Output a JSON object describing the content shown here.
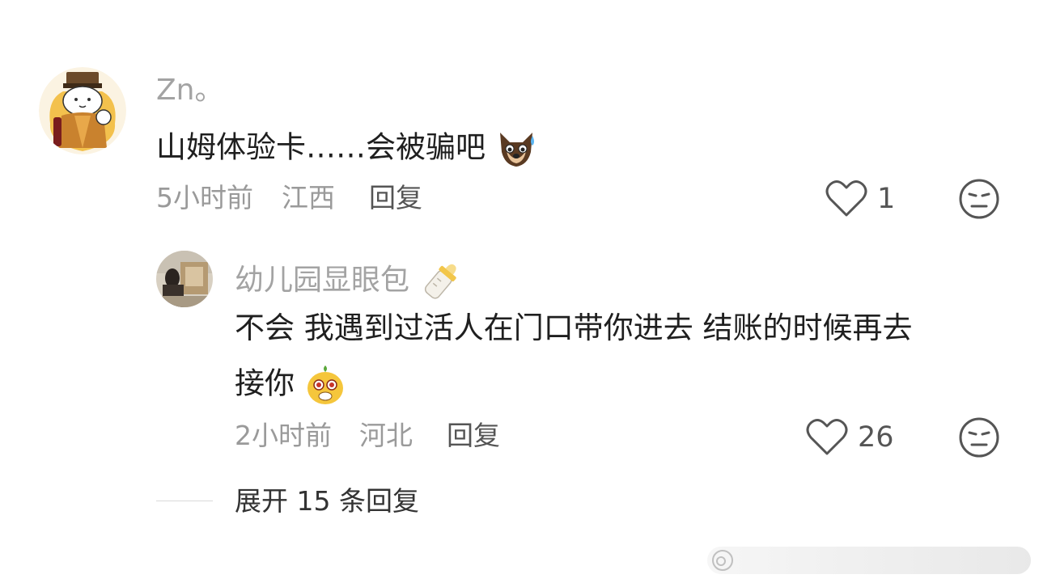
{
  "comment": {
    "username": "Zn。",
    "text": "山姆体验卡……会被骗吧",
    "emoji": "dog-sweat-emoji",
    "time": "5小时前",
    "location": "江西",
    "reply_label": "回复",
    "likes": "1",
    "avatar": "cat-emperor-avatar"
  },
  "reply": {
    "username": "幼儿园显眼包",
    "username_emoji": "baby-bottle-emoji",
    "text_line1": "不会 我遇到过活人在门口带你进去 结账的时候再去",
    "text_line2": "接你",
    "emoji": "dizzy-face-emoji",
    "time": "2小时前",
    "location": "河北",
    "reply_label": "回复",
    "likes": "26"
  },
  "expand": {
    "label": "展开 15 条回复"
  },
  "colors": {
    "username": "#a3a3a3",
    "text": "#1f1f1f",
    "meta": "#9a9a9a",
    "icon": "#555555"
  }
}
